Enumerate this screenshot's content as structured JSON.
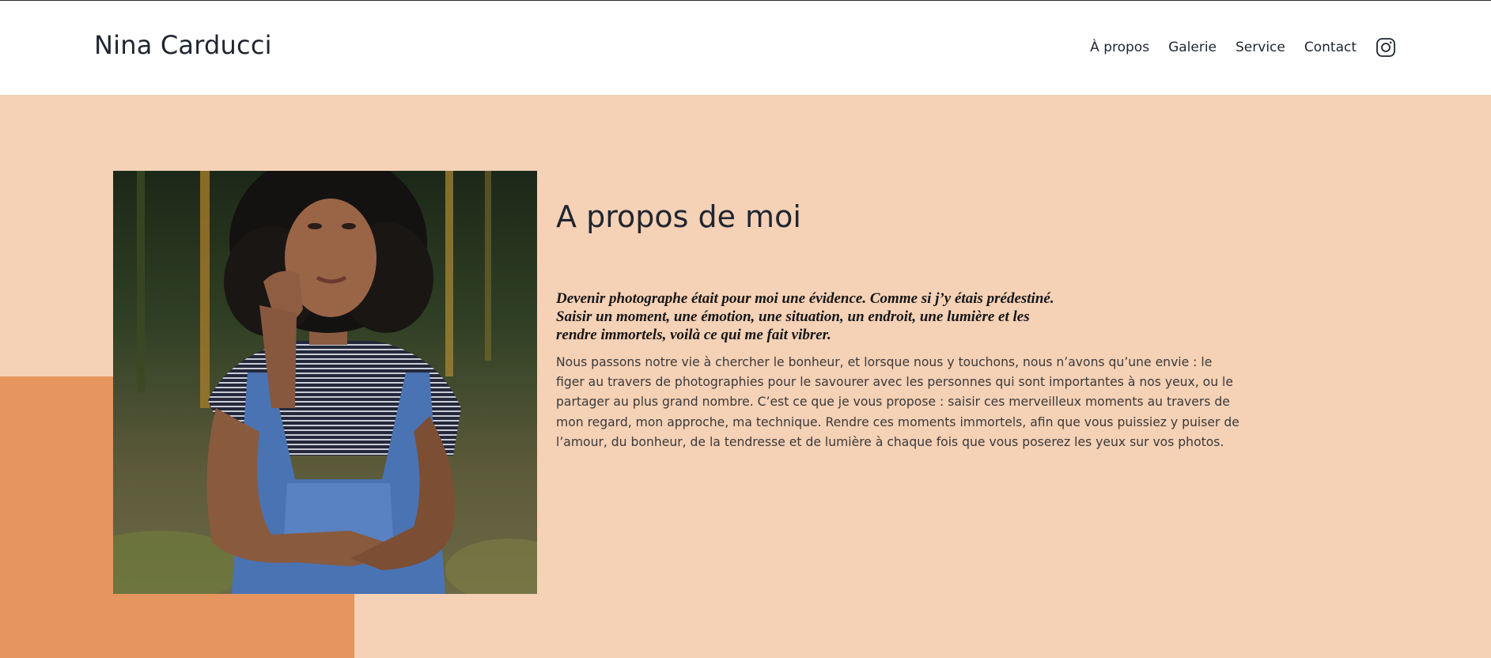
{
  "header": {
    "brand": "Nina Carducci",
    "nav": [
      {
        "label": "À propos"
      },
      {
        "label": "Galerie"
      },
      {
        "label": "Service"
      },
      {
        "label": "Contact"
      }
    ],
    "social_icon": "instagram-icon"
  },
  "about": {
    "title": "A propos de moi",
    "lead": "Devenir photographe était pour moi une évidence. Comme si j’y étais prédestiné. Saisir un moment, une émotion, une situation, un endroit, une lumière et les rendre immortels, voilà ce qui me fait vibrer.",
    "body": "Nous passons notre vie à chercher le bonheur, et lorsque nous y touchons, nous n’avons qu’une envie : le figer au travers de photographies pour le savourer avec les personnes qui sont importantes à nos yeux, ou le partager au plus grand nombre. C’est ce que je vous propose : saisir ces merveilleux moments au travers de mon regard, mon approche, ma technique. Rendre ces moments immortels, afin que vous puissiez y puiser de l’amour, du bonheur, de la tendresse et de lumière à chaque fois que vous poserez les yeux sur vos photos."
  },
  "colors": {
    "hero_background": "#f5d1b6",
    "accent_block": "#e6955f",
    "text_dark": "#1f2630"
  }
}
